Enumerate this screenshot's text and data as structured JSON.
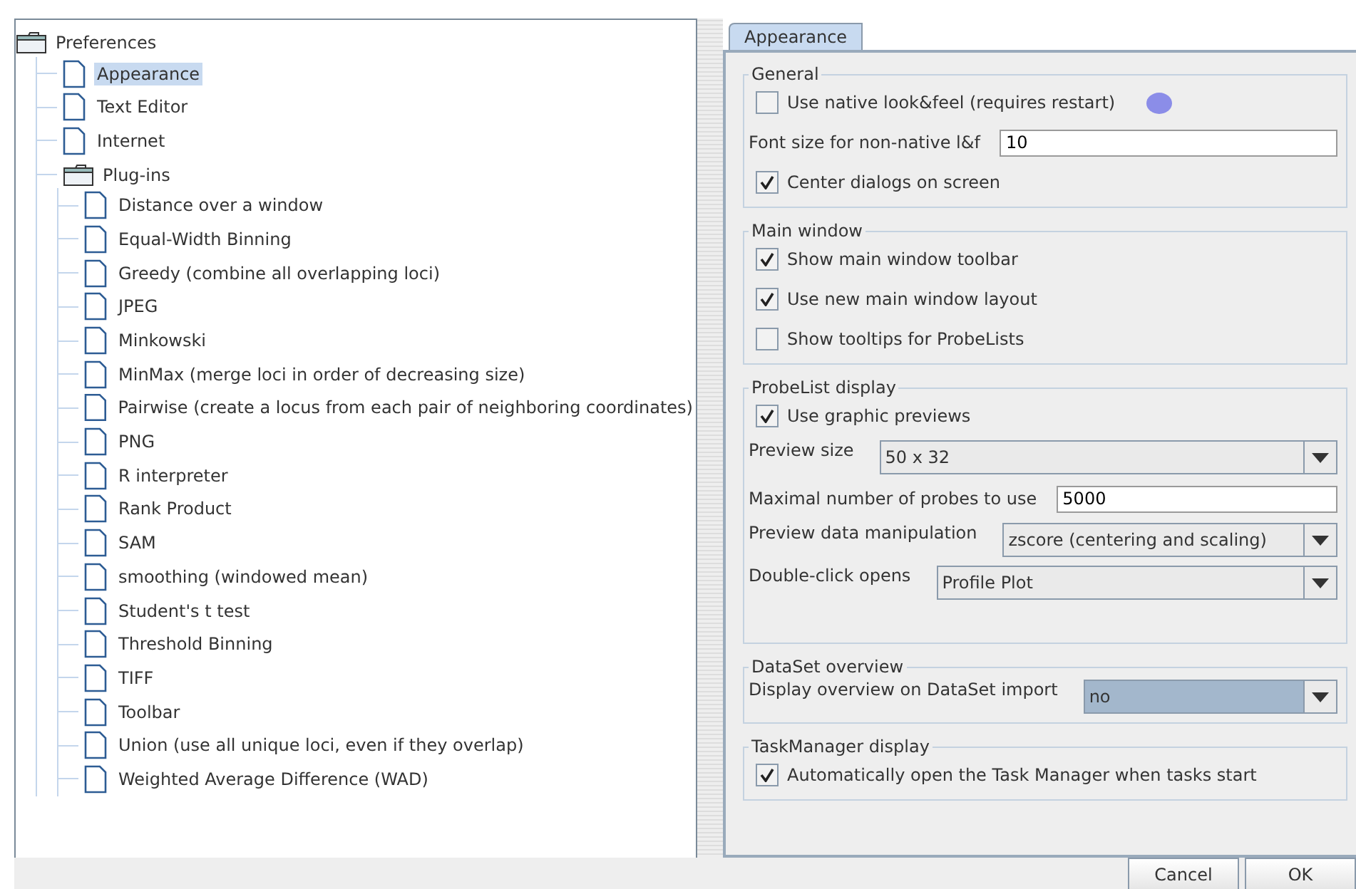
{
  "tree": {
    "label": "Preferences",
    "kind": "folder",
    "selected": false,
    "expanded": true,
    "children": [
      {
        "label": "Appearance",
        "kind": "leaf",
        "selected": true
      },
      {
        "label": "Text Editor",
        "kind": "leaf",
        "selected": false
      },
      {
        "label": "Internet",
        "kind": "leaf",
        "selected": false
      },
      {
        "label": "Plug-ins",
        "kind": "folder",
        "selected": false,
        "expanded": true,
        "children": [
          {
            "label": "Distance over a window",
            "kind": "leaf",
            "selected": false
          },
          {
            "label": "Equal-Width Binning",
            "kind": "leaf",
            "selected": false
          },
          {
            "label": "Greedy (combine all overlapping loci)",
            "kind": "leaf",
            "selected": false
          },
          {
            "label": "JPEG",
            "kind": "leaf",
            "selected": false
          },
          {
            "label": "Minkowski",
            "kind": "leaf",
            "selected": false
          },
          {
            "label": "MinMax (merge loci in order of decreasing size)",
            "kind": "leaf",
            "selected": false
          },
          {
            "label": "Pairwise (create a locus from each pair of neighboring coordinates)",
            "kind": "leaf",
            "selected": false
          },
          {
            "label": "PNG",
            "kind": "leaf",
            "selected": false
          },
          {
            "label": "R interpreter",
            "kind": "leaf",
            "selected": false
          },
          {
            "label": "Rank Product",
            "kind": "leaf",
            "selected": false
          },
          {
            "label": "SAM",
            "kind": "leaf",
            "selected": false
          },
          {
            "label": "smoothing (windowed mean)",
            "kind": "leaf",
            "selected": false
          },
          {
            "label": "Student's t test",
            "kind": "leaf",
            "selected": false
          },
          {
            "label": "Threshold Binning",
            "kind": "leaf",
            "selected": false
          },
          {
            "label": "TIFF",
            "kind": "leaf",
            "selected": false
          },
          {
            "label": "Toolbar",
            "kind": "leaf",
            "selected": false
          },
          {
            "label": "Union (use all unique loci, even if they overlap)",
            "kind": "leaf",
            "selected": false
          },
          {
            "label": "Weighted Average Difference (WAD)",
            "kind": "leaf",
            "selected": false
          }
        ]
      }
    ]
  },
  "tabs": [
    {
      "label": "Appearance",
      "selected": true
    }
  ],
  "sections": [
    {
      "title": "General",
      "rows": [
        {
          "kind": "checkbox",
          "label": "Use native look&feel (requires restart)",
          "checked": false,
          "help": true
        },
        {
          "kind": "text",
          "label": "Font size for non-native l&f",
          "value": "10"
        },
        {
          "kind": "checkbox",
          "label": "Center dialogs on screen",
          "checked": true,
          "help": false
        }
      ]
    },
    {
      "title": "Main window",
      "rows": [
        {
          "kind": "checkbox",
          "label": "Show main window toolbar",
          "checked": true,
          "help": false
        },
        {
          "kind": "checkbox",
          "label": "Use new main window layout",
          "checked": true,
          "help": false
        },
        {
          "kind": "checkbox",
          "label": "Show tooltips for ProbeLists",
          "checked": false,
          "help": false
        }
      ]
    },
    {
      "title": "ProbeList display",
      "rows": [
        {
          "kind": "checkbox",
          "label": "Use graphic previews",
          "checked": true,
          "help": false
        },
        {
          "kind": "dropdown",
          "label": "Preview size",
          "value": "50 x 32",
          "focused": false
        },
        {
          "kind": "text",
          "label": "Maximal number of probes to use",
          "value": "5000"
        },
        {
          "kind": "dropdown",
          "label": "Preview data manipulation",
          "value": "zscore (centering and scaling)",
          "focused": false
        },
        {
          "kind": "dropdown",
          "label": "Double-click opens",
          "value": "Profile Plot",
          "focused": false
        }
      ]
    },
    {
      "title": "DataSet overview",
      "rows": [
        {
          "kind": "dropdown",
          "label": "Display overview on DataSet import",
          "value": "no",
          "focused": true
        }
      ]
    },
    {
      "title": "TaskManager display",
      "rows": [
        {
          "kind": "checkbox",
          "label": "Automatically open the Task Manager when tasks start",
          "checked": true,
          "help": false
        }
      ]
    }
  ],
  "buttons": [
    "Cancel",
    "OK"
  ]
}
